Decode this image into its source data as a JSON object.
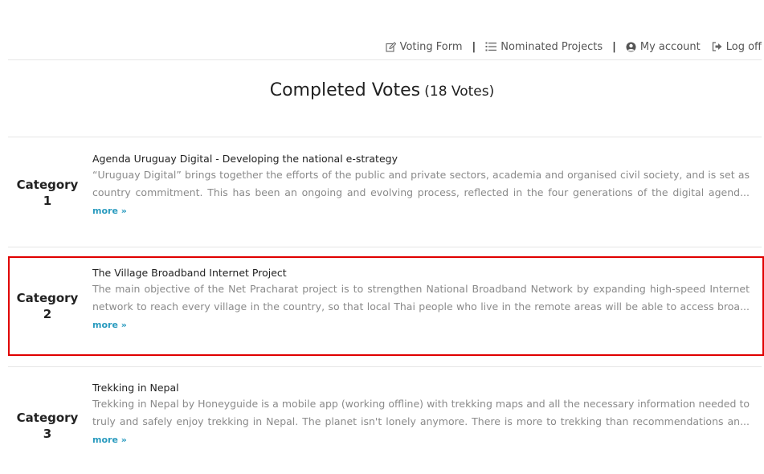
{
  "nav": {
    "voting_form": "Voting Form",
    "nominated_projects": "Nominated Projects",
    "my_account": "My account",
    "log_off": "Log off",
    "separator": "|"
  },
  "page": {
    "title": "Completed Votes",
    "count": "(18 Votes)"
  },
  "votes": [
    {
      "category_word": "Category",
      "category_num": "1",
      "title": "Agenda Uruguay Digital - Developing the national e-strategy",
      "description": "“Uruguay Digital” brings together the efforts of the public and private sectors, academia and organised civil society, and is set as country commitment. This has been an ongoing and evolving process, reflected in the four generations of the digital agend...",
      "more": "more »"
    },
    {
      "category_word": "Category",
      "category_num": "2",
      "title": "The Village Broadband Internet Project",
      "description": "The main objective of the Net Pracharat project is to strengthen National Broadband Network by expanding high-speed Internet network to reach every village in the country, so that local Thai people who live in the remote areas will be able to access broa...",
      "more": "more »"
    },
    {
      "category_word": "Category",
      "category_num": "3",
      "title": "Trekking in Nepal",
      "description": "Trekking in Nepal by Honeyguide is a mobile app (working offline) with trekking maps and all the necessary information needed to truly and safely enjoy trekking in Nepal. The planet isn't lonely anymore. There is more to trekking than recommendations an...",
      "more": "more »"
    }
  ],
  "colors": {
    "accent_link": "#2a9bbf",
    "highlight_border": "#e00000",
    "desc_text": "#8a8a8a"
  },
  "icons": {
    "voting_form": "edit-icon",
    "nominated_projects": "list-icon",
    "my_account": "user-circle-icon",
    "log_off": "sign-out-icon"
  }
}
